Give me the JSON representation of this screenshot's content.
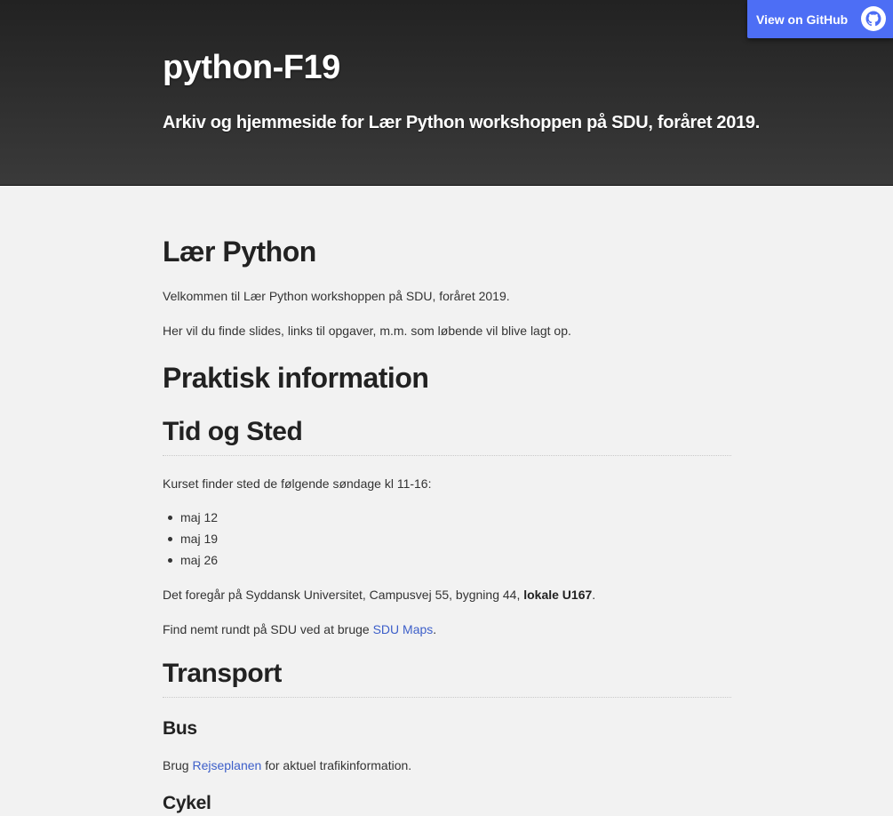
{
  "header": {
    "title": "python-F19",
    "description": "Arkiv og hjemmeside for Lær Python workshoppen på SDU, foråret 2019.",
    "github_button": {
      "label": "View on GitHub",
      "icon": "github-octocat-icon"
    }
  },
  "content": {
    "intro": {
      "heading": "Lær Python",
      "paragraphs": [
        "Velkommen til Lær Python workshoppen på SDU, foråret 2019.",
        "Her vil du finde slides, links til opgaver, m.m. som løbende vil blive lagt op."
      ]
    },
    "practical": {
      "heading": "Praktisk information"
    },
    "time_place": {
      "heading": "Tid og Sted",
      "intro": "Kurset finder sted de følgende søndage kl 11-16:",
      "dates": [
        "maj 12",
        "maj 19",
        "maj 26"
      ],
      "location_prefix": "Det foregår på Syddansk Universitet, Campusvej 55, bygning 44, ",
      "location_bold": "lokale U167",
      "location_suffix": ".",
      "maps_prefix": "Find nemt rundt på SDU ved at bruge ",
      "maps_link": "SDU Maps",
      "maps_suffix": "."
    },
    "transport": {
      "heading": "Transport",
      "bus": {
        "heading": "Bus",
        "prefix": "Brug ",
        "link": "Rejseplanen",
        "suffix": " for aktuel trafikinformation."
      },
      "bike": {
        "heading": "Cykel"
      }
    }
  },
  "colors": {
    "header_bg": "#2a2a2a",
    "button_bg": "#4d6ef5",
    "link": "#3d5fc9",
    "page_bg": "#f2f2f2"
  }
}
